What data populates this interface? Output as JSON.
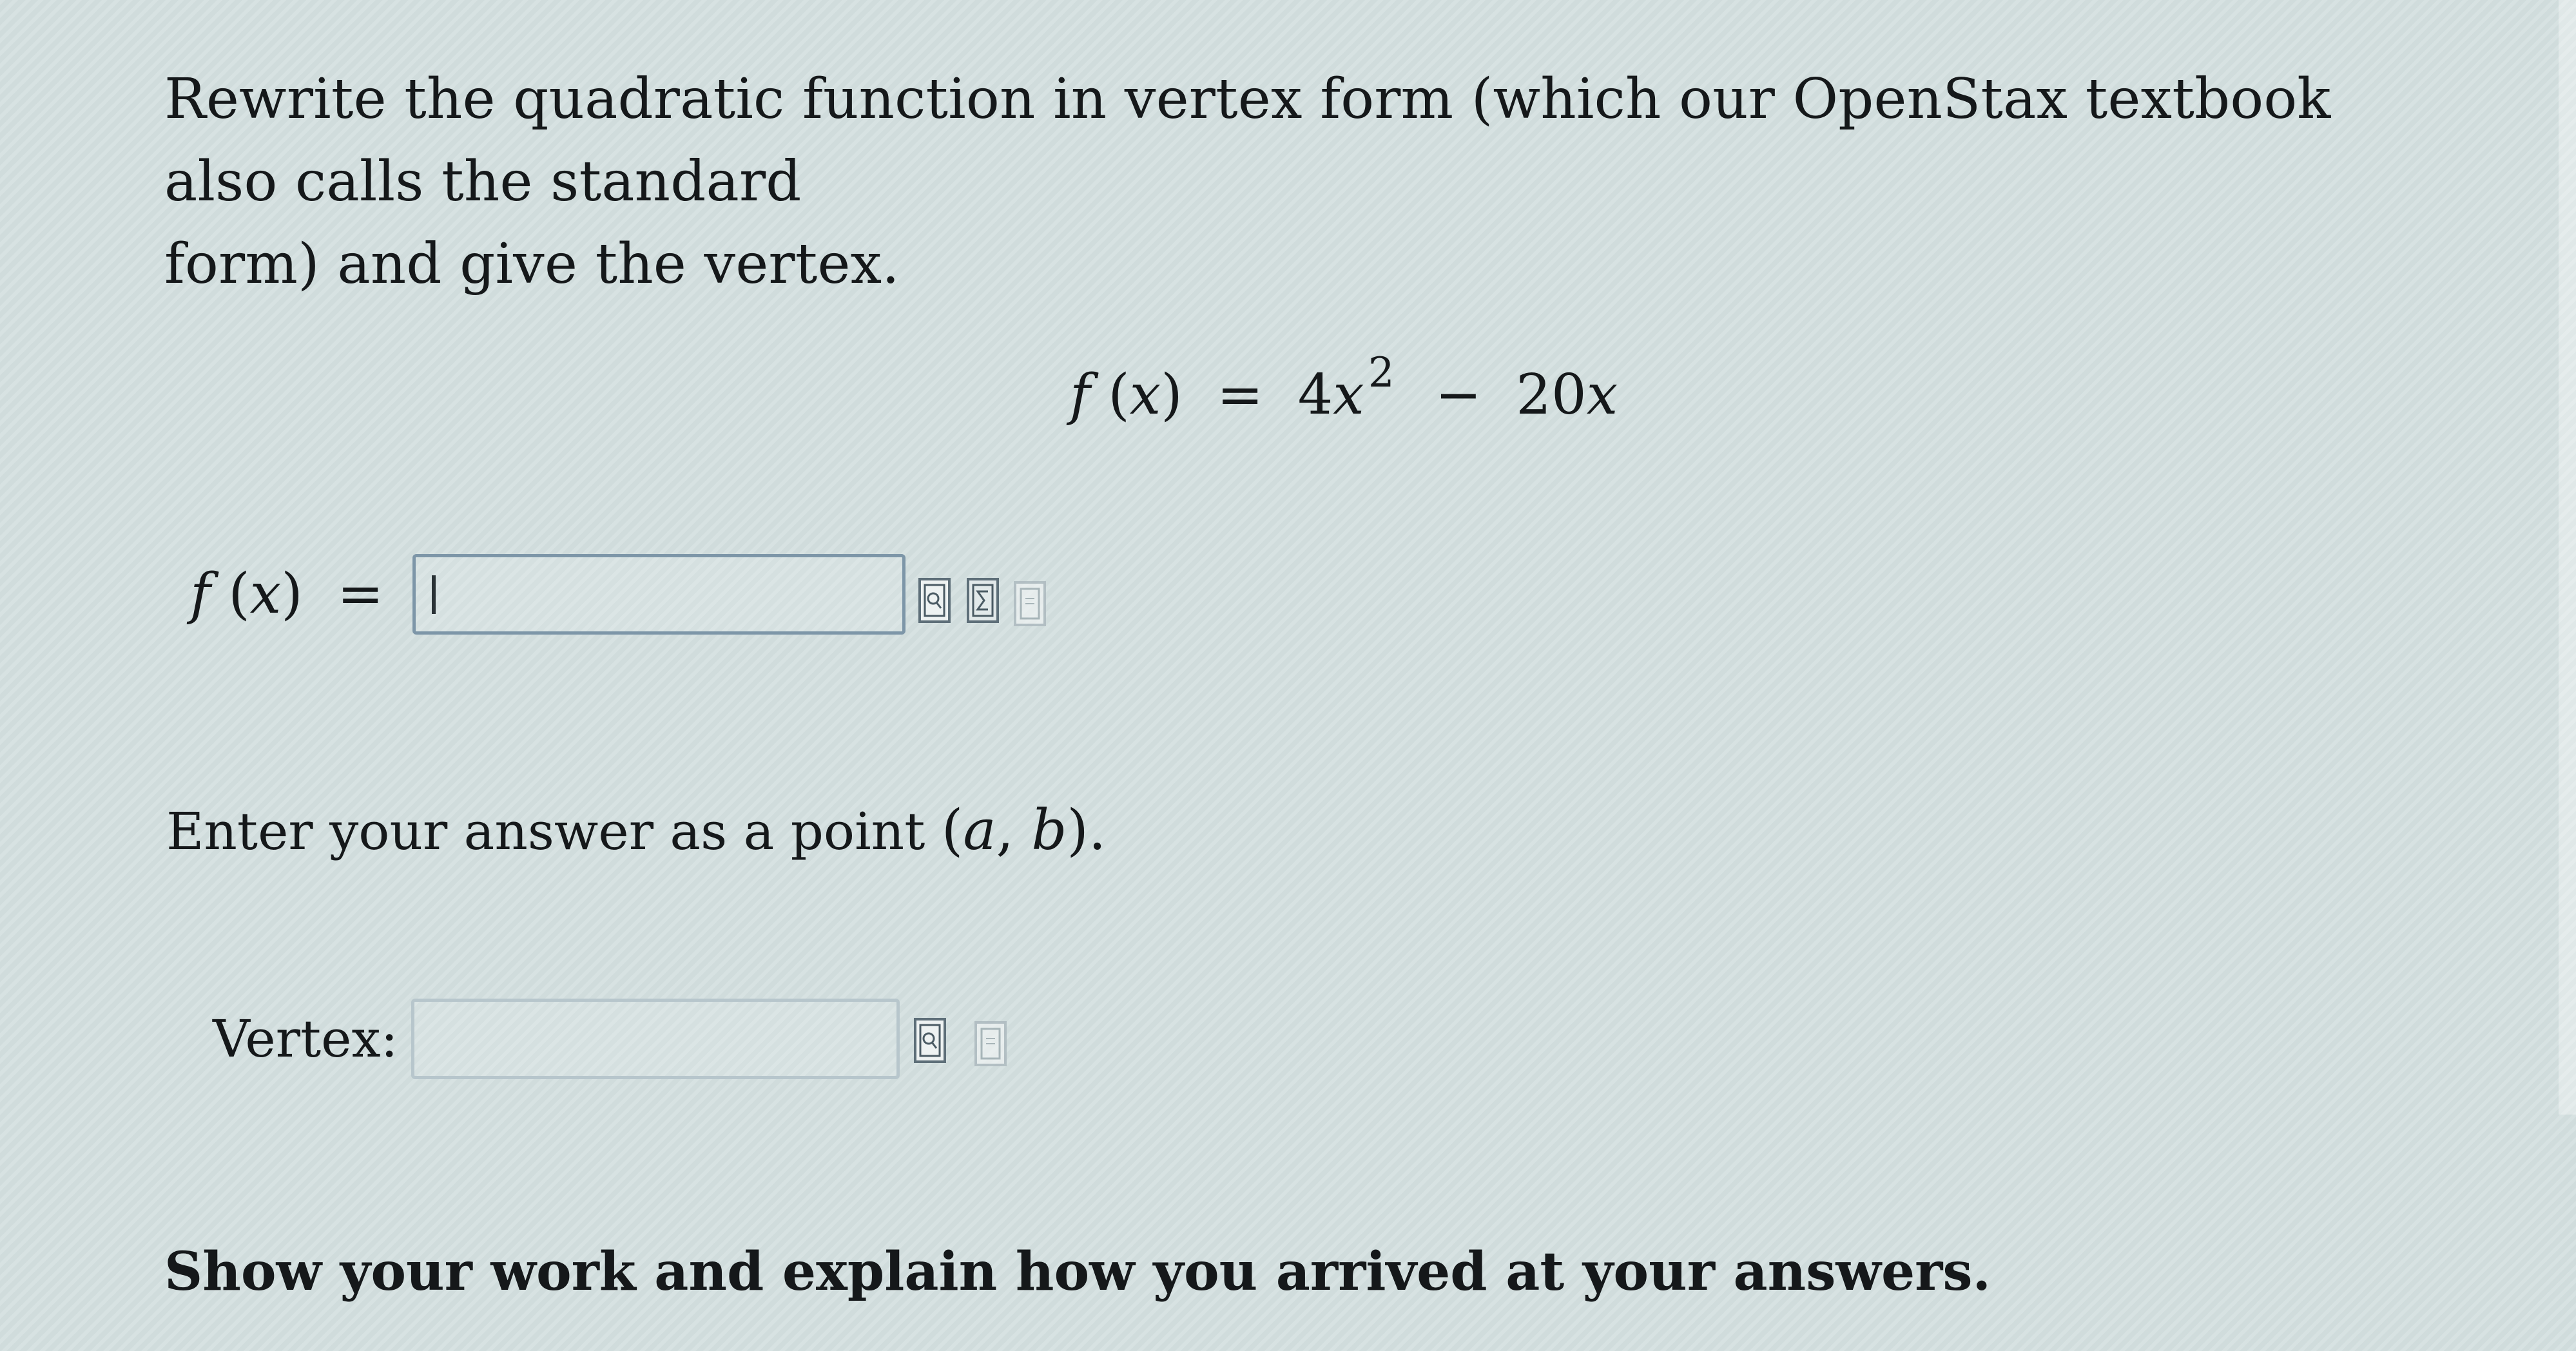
{
  "question": {
    "instruction_line1": "Rewrite the quadratic function in vertex form (which our OpenStax textbook also calls the standard",
    "instruction_line2": "form) and give the vertex."
  },
  "given_equation": {
    "function_name": "f",
    "variable": "x",
    "equals": "=",
    "coefficient": "4",
    "exponent": "2",
    "operator": "−",
    "second_term_coefficient": "20"
  },
  "fx_answer": {
    "label_function": "f",
    "label_variable": "x",
    "label_equals": "=",
    "value": ""
  },
  "vertex_answer": {
    "hint_text": "Enter your answer as a point",
    "point_a": "a",
    "point_b": "b",
    "label": "Vertex:",
    "value": ""
  },
  "work": {
    "prompt": "Show your work and explain how you arrived at your answers."
  },
  "icons": {
    "preview": "preview-icon",
    "equation_editor": "equation-editor-icon",
    "page": "page-icon"
  }
}
